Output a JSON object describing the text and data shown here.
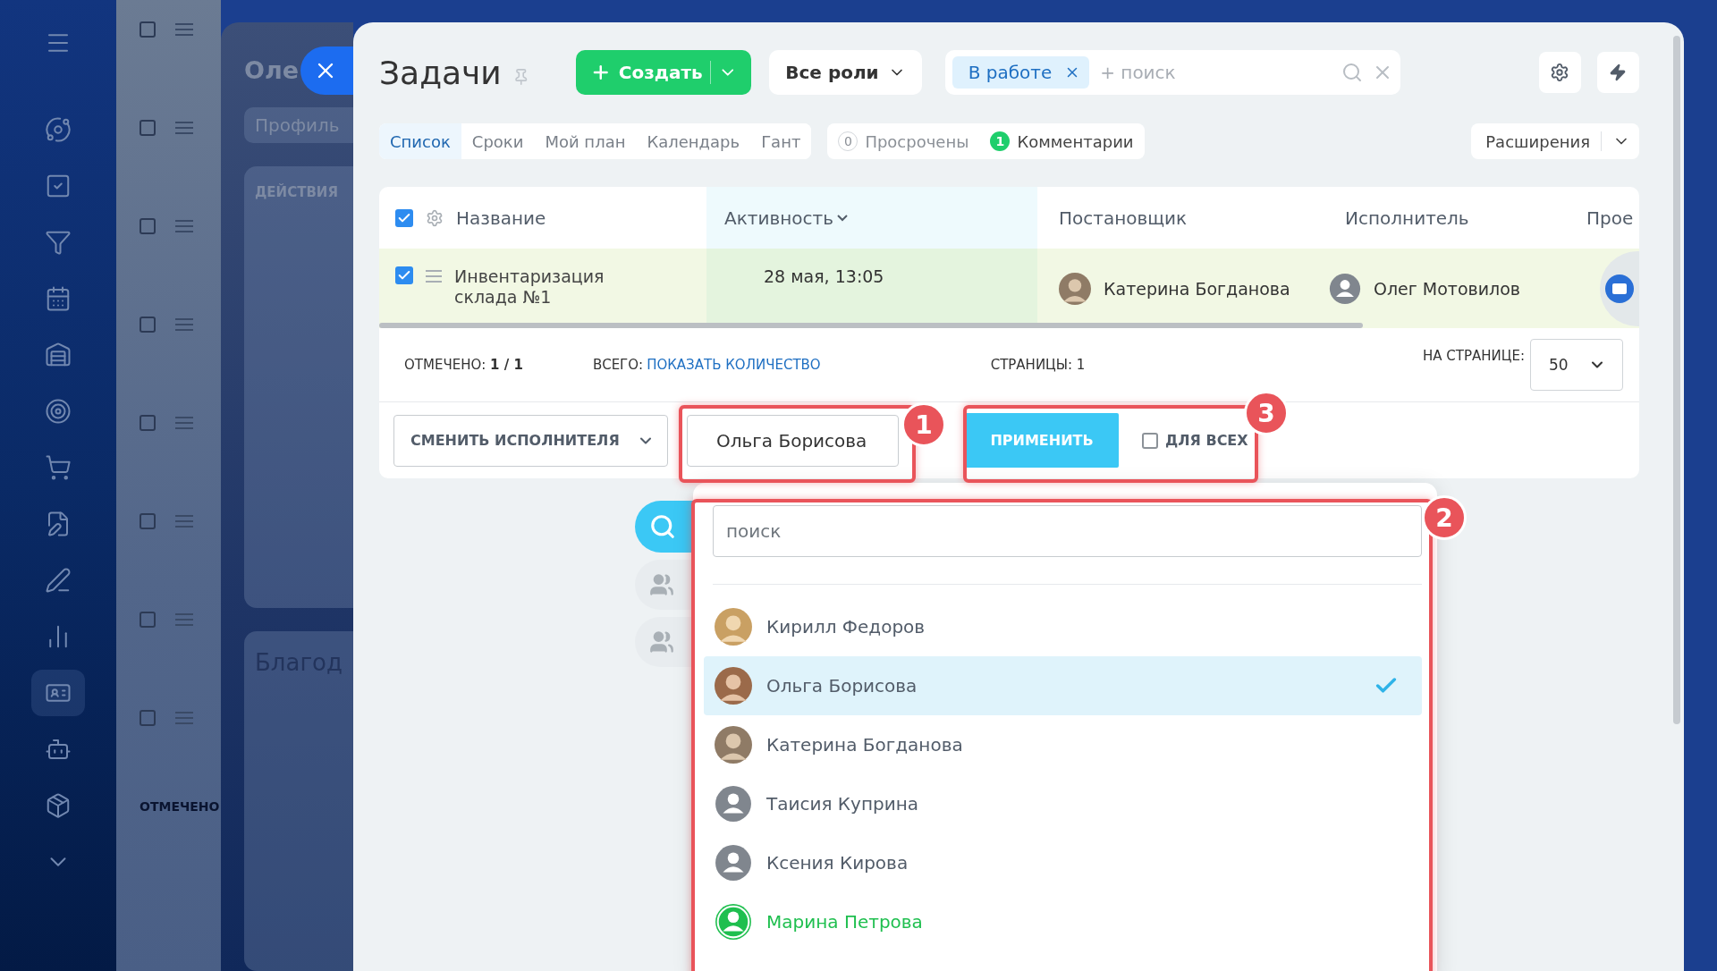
{
  "sidebar": {
    "items": [
      {
        "kind": "menu",
        "selected": false
      },
      {
        "kind": "orbit",
        "selected": false
      },
      {
        "kind": "tasks",
        "selected": false
      },
      {
        "kind": "funnel",
        "selected": false
      },
      {
        "kind": "calendar",
        "selected": false
      },
      {
        "kind": "warehouse",
        "selected": false
      },
      {
        "kind": "target",
        "selected": false
      },
      {
        "kind": "cart",
        "selected": false
      },
      {
        "kind": "document",
        "selected": false
      },
      {
        "kind": "pen",
        "selected": false
      },
      {
        "kind": "chart",
        "selected": false
      },
      {
        "kind": "card",
        "selected": true
      },
      {
        "kind": "bot",
        "selected": false
      },
      {
        "kind": "package",
        "selected": false
      },
      {
        "kind": "more",
        "selected": false
      }
    ]
  },
  "background_list": {
    "rows": [
      {
        "checked": false
      },
      {
        "checked": false
      },
      {
        "checked": false
      },
      {
        "checked": false
      },
      {
        "checked": false
      },
      {
        "checked": false
      },
      {
        "checked": false
      },
      {
        "checked": false
      }
    ],
    "footer_label": "ОТМЕЧЕНО"
  },
  "background_panel": {
    "title": "Оле",
    "tab": "Профиль",
    "actions_label": "ДЕЙСТВИЯ",
    "card_title": "Благод"
  },
  "panel": {
    "title": "Задачи",
    "create_button": "Создать",
    "roles_button": "Все роли",
    "filter": {
      "chips": [
        {
          "label": "В работе"
        }
      ],
      "placeholder": "+ поиск"
    }
  },
  "view_tabs": [
    {
      "label": "Список",
      "selected": true
    },
    {
      "label": "Сроки",
      "selected": false
    },
    {
      "label": "Мой план",
      "selected": false
    },
    {
      "label": "Календарь",
      "selected": false
    },
    {
      "label": "Гант",
      "selected": false
    }
  ],
  "counters": [
    {
      "count": "0",
      "label": "Просрочены",
      "active": false
    },
    {
      "count": "1",
      "label": "Комментарии",
      "active": true
    }
  ],
  "extensions_button": "Расширения",
  "table": {
    "all_checked": true,
    "columns": [
      {
        "label": "Название",
        "sorted": false
      },
      {
        "label": "Активность",
        "sorted": true
      },
      {
        "label": "Постановщик",
        "sorted": false
      },
      {
        "label": "Исполнитель",
        "sorted": false
      },
      {
        "label": "Прое",
        "sorted": false
      }
    ],
    "rows": [
      {
        "checked": true,
        "title": "Инвентаризация склада №1",
        "activity": "28 мая, 13:05",
        "creator": {
          "name": "Катерина Богданова",
          "kind": "photo"
        },
        "assignee": {
          "name": "Олег Мотовилов",
          "kind": "placeholder"
        }
      }
    ]
  },
  "footer": {
    "marked_label": "ОТМЕЧЕНО:",
    "marked_value": "1 / 1",
    "total_label": "ВСЕГО:",
    "total_link": "ПОКАЗАТЬ КОЛИЧЕСТВО",
    "pages_label": "СТРАНИЦЫ:",
    "pages_value": "1",
    "per_page_label": "НА СТРАНИЦЕ:",
    "per_page_value": "50"
  },
  "actions": {
    "action_select": "СМЕНИТЬ ИСПОЛНИТЕЛЯ",
    "user_field": "Ольга Борисова",
    "apply_button": "ПРИМЕНИТЬ",
    "for_all": {
      "label": "ДЛЯ ВСЕХ",
      "checked": false
    }
  },
  "user_popup": {
    "search_placeholder": "поиск",
    "tabs": [
      {
        "kind": "search",
        "selected": true
      },
      {
        "kind": "group",
        "selected": false
      },
      {
        "kind": "group",
        "selected": false
      }
    ],
    "users": [
      {
        "name": "Кирилл Федоров",
        "kind": "photo",
        "selected": false,
        "color": "#525c69"
      },
      {
        "name": "Ольга Борисова",
        "kind": "photo",
        "selected": true,
        "color": "#525c69"
      },
      {
        "name": "Катерина Богданова",
        "kind": "photo",
        "selected": false,
        "color": "#525c69"
      },
      {
        "name": "Таисия Куприна",
        "kind": "placeholder",
        "selected": false,
        "color": "#525c69"
      },
      {
        "name": "Ксения Кирова",
        "kind": "placeholder",
        "selected": false,
        "color": "#525c69"
      },
      {
        "name": "Марина Петрова",
        "kind": "online",
        "selected": false,
        "color": "#1fbf4f"
      }
    ]
  },
  "annotations": [
    {
      "number": "1"
    },
    {
      "number": "2"
    },
    {
      "number": "3"
    }
  ]
}
